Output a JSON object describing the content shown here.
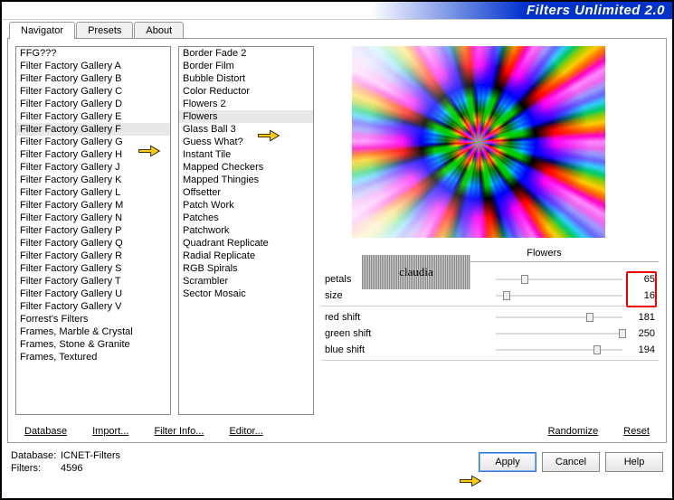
{
  "header": {
    "title": "Filters Unlimited 2.0"
  },
  "tabs": [
    {
      "label": "Navigator",
      "active": true
    },
    {
      "label": "Presets",
      "active": false
    },
    {
      "label": "About",
      "active": false
    }
  ],
  "categories": [
    "FFG???",
    "Filter Factory Gallery A",
    "Filter Factory Gallery B",
    "Filter Factory Gallery C",
    "Filter Factory Gallery D",
    "Filter Factory Gallery E",
    "Filter Factory Gallery F",
    "Filter Factory Gallery G",
    "Filter Factory Gallery H",
    "Filter Factory Gallery J",
    "Filter Factory Gallery K",
    "Filter Factory Gallery L",
    "Filter Factory Gallery M",
    "Filter Factory Gallery N",
    "Filter Factory Gallery P",
    "Filter Factory Gallery Q",
    "Filter Factory Gallery R",
    "Filter Factory Gallery S",
    "Filter Factory Gallery T",
    "Filter Factory Gallery U",
    "Filter Factory Gallery V",
    "Forrest's Filters",
    "Frames, Marble & Crystal",
    "Frames, Stone & Granite",
    "Frames, Textured"
  ],
  "selected_category_index": 6,
  "filters": [
    "Border Fade 2",
    "Border Film",
    "Bubble Distort",
    "Color Reductor",
    "Flowers 2",
    "Flowers",
    "Glass Ball 3",
    "Guess What?",
    "Instant Tile",
    "Mapped Checkers",
    "Mapped Thingies",
    "Offsetter",
    "Patch Work",
    "Patches",
    "Patchwork",
    "Quadrant Replicate",
    "Radial Replicate",
    "RGB Spirals",
    "Scrambler",
    "Sector Mosaic"
  ],
  "selected_filter_index": 5,
  "filter_name": "Flowers",
  "watermark": "claudia",
  "param_groups": [
    [
      {
        "name": "petals",
        "value": 65,
        "pos": 28
      },
      {
        "name": "size",
        "value": 16,
        "pos": 8
      }
    ],
    [
      {
        "name": "red shift",
        "value": 181,
        "pos": 100
      },
      {
        "name": "green shift",
        "value": 250,
        "pos": 136
      },
      {
        "name": "blue shift",
        "value": 194,
        "pos": 108
      }
    ]
  ],
  "toolbar": {
    "database": "Database",
    "import": "Import...",
    "filter_info": "Filter Info...",
    "editor": "Editor...",
    "randomize": "Randomize",
    "reset": "Reset"
  },
  "status": {
    "db_label": "Database:",
    "db_value": "ICNET-Filters",
    "filters_label": "Filters:",
    "filters_value": "4596"
  },
  "buttons": {
    "apply": "Apply",
    "cancel": "Cancel",
    "help": "Help"
  }
}
